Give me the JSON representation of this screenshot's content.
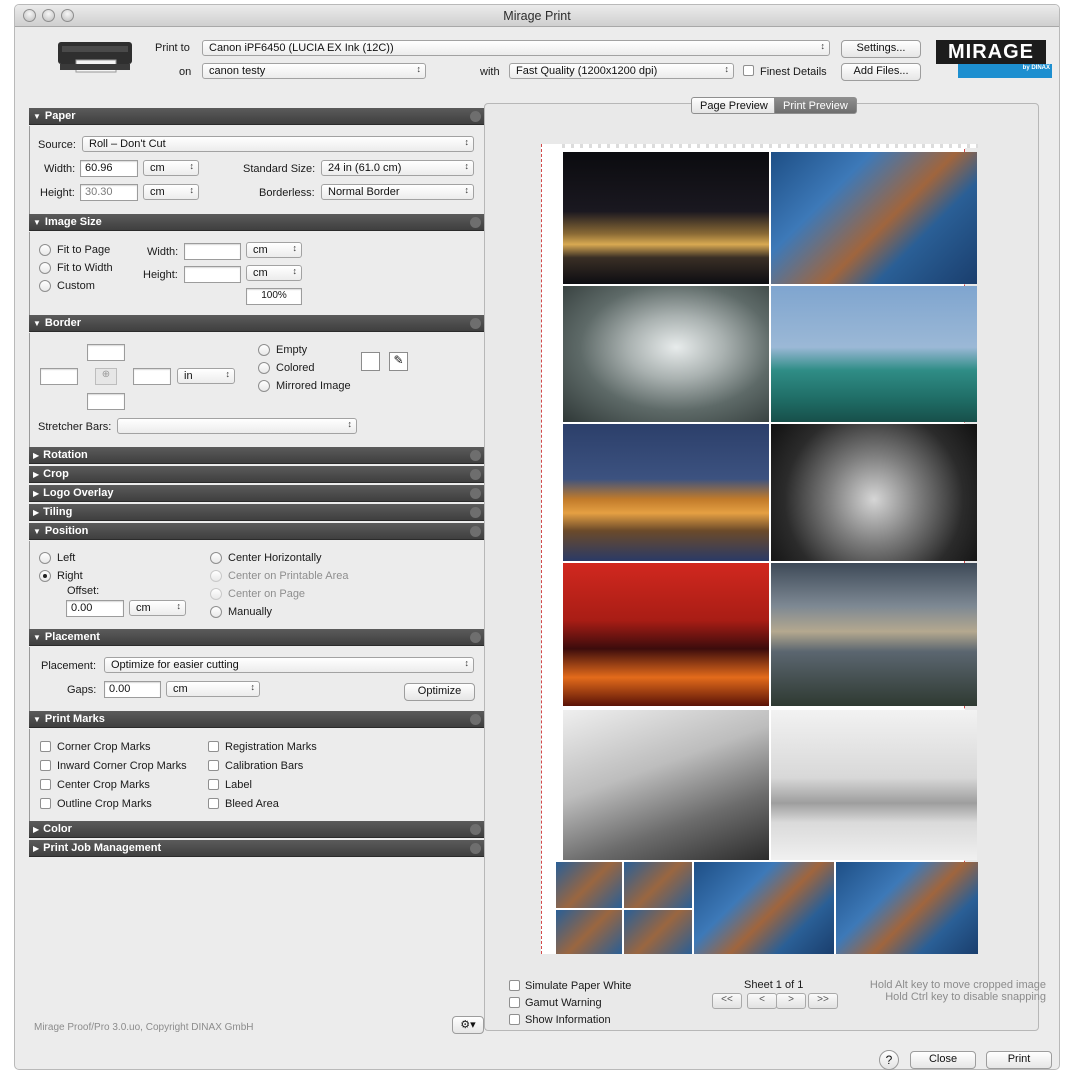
{
  "window": {
    "title": "Mirage Print"
  },
  "header": {
    "print_to_label": "Print to",
    "printer": "Canon iPF6450 (LUCIA EX Ink (12C))",
    "settings_button": "Settings...",
    "on_label": "on",
    "queue": "canon testy",
    "with_label": "with",
    "quality": "Fast Quality (1200x1200 dpi)",
    "finest_details": "Finest Details",
    "add_files_button": "Add Files...",
    "logo": {
      "word": "MIRAGE",
      "sub": "by DINAX"
    }
  },
  "sections": {
    "paper": "Paper",
    "image_size": "Image Size",
    "border": "Border",
    "rotation": "Rotation",
    "crop": "Crop",
    "logo_overlay": "Logo Overlay",
    "tiling": "Tiling",
    "position": "Position",
    "placement": "Placement",
    "print_marks": "Print Marks",
    "color": "Color",
    "print_job_management": "Print Job Management"
  },
  "paper": {
    "source_label": "Source:",
    "source": "Roll – Don't Cut",
    "width_label": "Width:",
    "width": "60.96",
    "width_unit": "cm",
    "height_label": "Height:",
    "height": "30.30",
    "height_unit": "cm",
    "standard_size_label": "Standard Size:",
    "standard_size": "24 in (61.0 cm)",
    "borderless_label": "Borderless:",
    "borderless": "Normal Border"
  },
  "image_size": {
    "fit_to_page": "Fit to Page",
    "fit_to_width": "Fit to Width",
    "custom": "Custom",
    "width_label": "Width:",
    "width_unit": "cm",
    "height_label": "Height:",
    "height_unit": "cm",
    "percent": "100%"
  },
  "border": {
    "unit": "in",
    "empty": "Empty",
    "colored": "Colored",
    "mirrored_image": "Mirrored Image",
    "stretcher_bars_label": "Stretcher Bars:"
  },
  "position": {
    "left": "Left",
    "right": "Right",
    "offset_label": "Offset:",
    "offset": "0.00",
    "offset_unit": "cm",
    "center_horizontally": "Center Horizontally",
    "center_printable": "Center on Printable Area",
    "center_page": "Center on Page",
    "manually": "Manually"
  },
  "placement": {
    "placement_label": "Placement:",
    "placement": "Optimize for easier cutting",
    "gaps_label": "Gaps:",
    "gaps": "0.00",
    "gaps_unit": "cm",
    "optimize_button": "Optimize"
  },
  "print_marks": {
    "corner_crop": "Corner Crop Marks",
    "inward_corner_crop": "Inward Corner Crop Marks",
    "center_crop": "Center Crop Marks",
    "outline_crop": "Outline Crop Marks",
    "registration": "Registration Marks",
    "calibration": "Calibration Bars",
    "label": "Label",
    "bleed_area": "Bleed Area"
  },
  "footer": {
    "copyright": "Mirage Proof/Pro 3.0.uo, Copyright DINAX GmbH",
    "close_button": "Close",
    "print_button": "Print"
  },
  "preview": {
    "page_preview_tab": "Page Preview",
    "print_preview_tab": "Print Preview",
    "simulate_paper_white": "Simulate Paper White",
    "gamut_warning": "Gamut Warning",
    "show_information": "Show Information",
    "sheet": "Sheet 1 of 1",
    "nav_first": "<<",
    "nav_prev": "<",
    "nav_next": ">",
    "nav_last": ">>",
    "hint_alt": "Hold Alt key to move cropped image",
    "hint_ctrl": "Hold Ctrl key to disable snapping"
  }
}
